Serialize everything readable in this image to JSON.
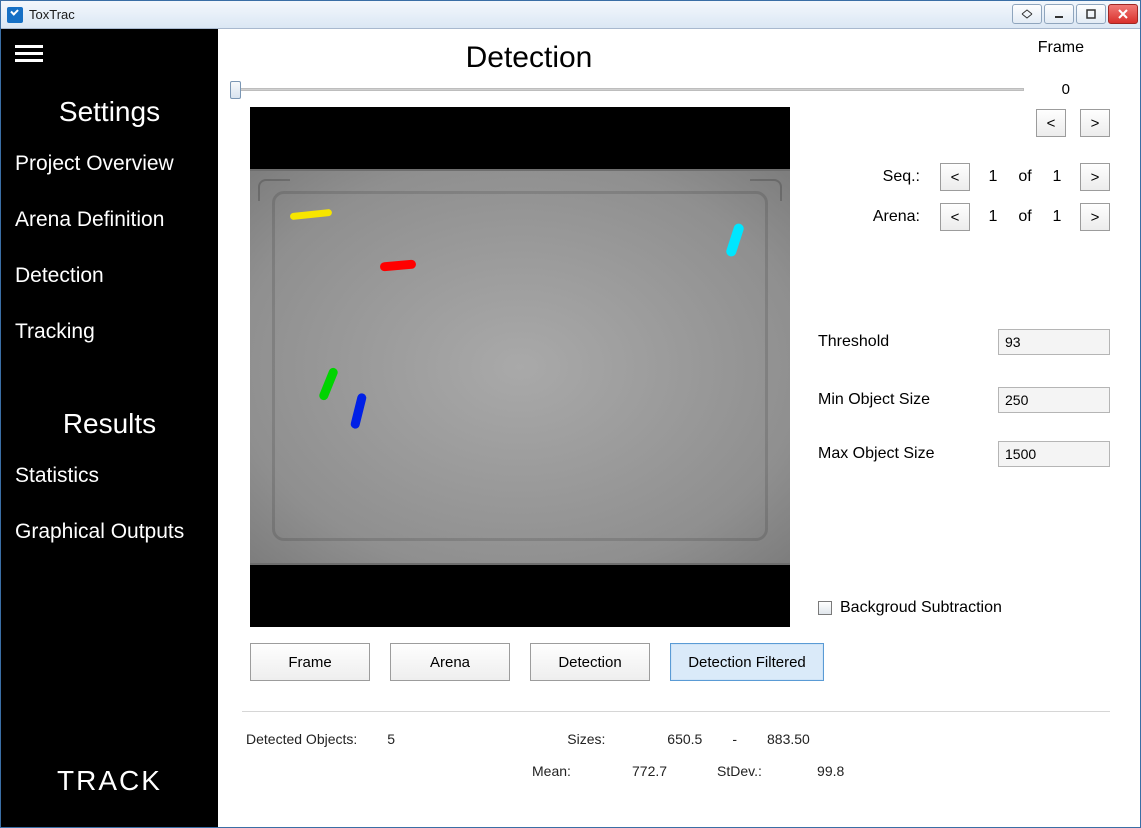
{
  "window": {
    "title": "ToxTrac"
  },
  "sidebar": {
    "headings": {
      "settings": "Settings",
      "results": "Results"
    },
    "links": {
      "project": "Project Overview",
      "arena": "Arena Definition",
      "detection": "Detection",
      "tracking": "Tracking",
      "statistics": "Statistics",
      "graphical": "Graphical Outputs"
    },
    "track": "TRACK"
  },
  "main": {
    "title": "Detection",
    "frame_label": "Frame",
    "frame_value": "0",
    "nav_prev": "<",
    "nav_next": ">",
    "seq": {
      "label": "Seq.:",
      "prev": "<",
      "cur": "1",
      "of": "of",
      "tot": "1",
      "next": ">"
    },
    "arena": {
      "label": "Arena:",
      "prev": "<",
      "cur": "1",
      "of": "of",
      "tot": "1",
      "next": ">"
    },
    "params": {
      "threshold": {
        "label": "Threshold",
        "value": "93"
      },
      "min": {
        "label": "Min Object Size",
        "value": "250"
      },
      "max": {
        "label": "Max Object Size",
        "value": "1500"
      }
    },
    "bg_sub": {
      "label": "Backgroud Subtraction",
      "checked": false
    },
    "view_buttons": {
      "frame": "Frame",
      "arena": "Arena",
      "detection": "Detection",
      "filtered": "Detection Filtered"
    },
    "stats": {
      "detected_label": "Detected Objects:",
      "detected_value": "5",
      "sizes_label": "Sizes:",
      "sizes_min": "650.5",
      "sizes_dash": "-",
      "sizes_max": "883.50",
      "mean_label": "Mean:",
      "mean_value": "772.7",
      "std_label": "StDev.:",
      "std_value": "99.8"
    }
  }
}
